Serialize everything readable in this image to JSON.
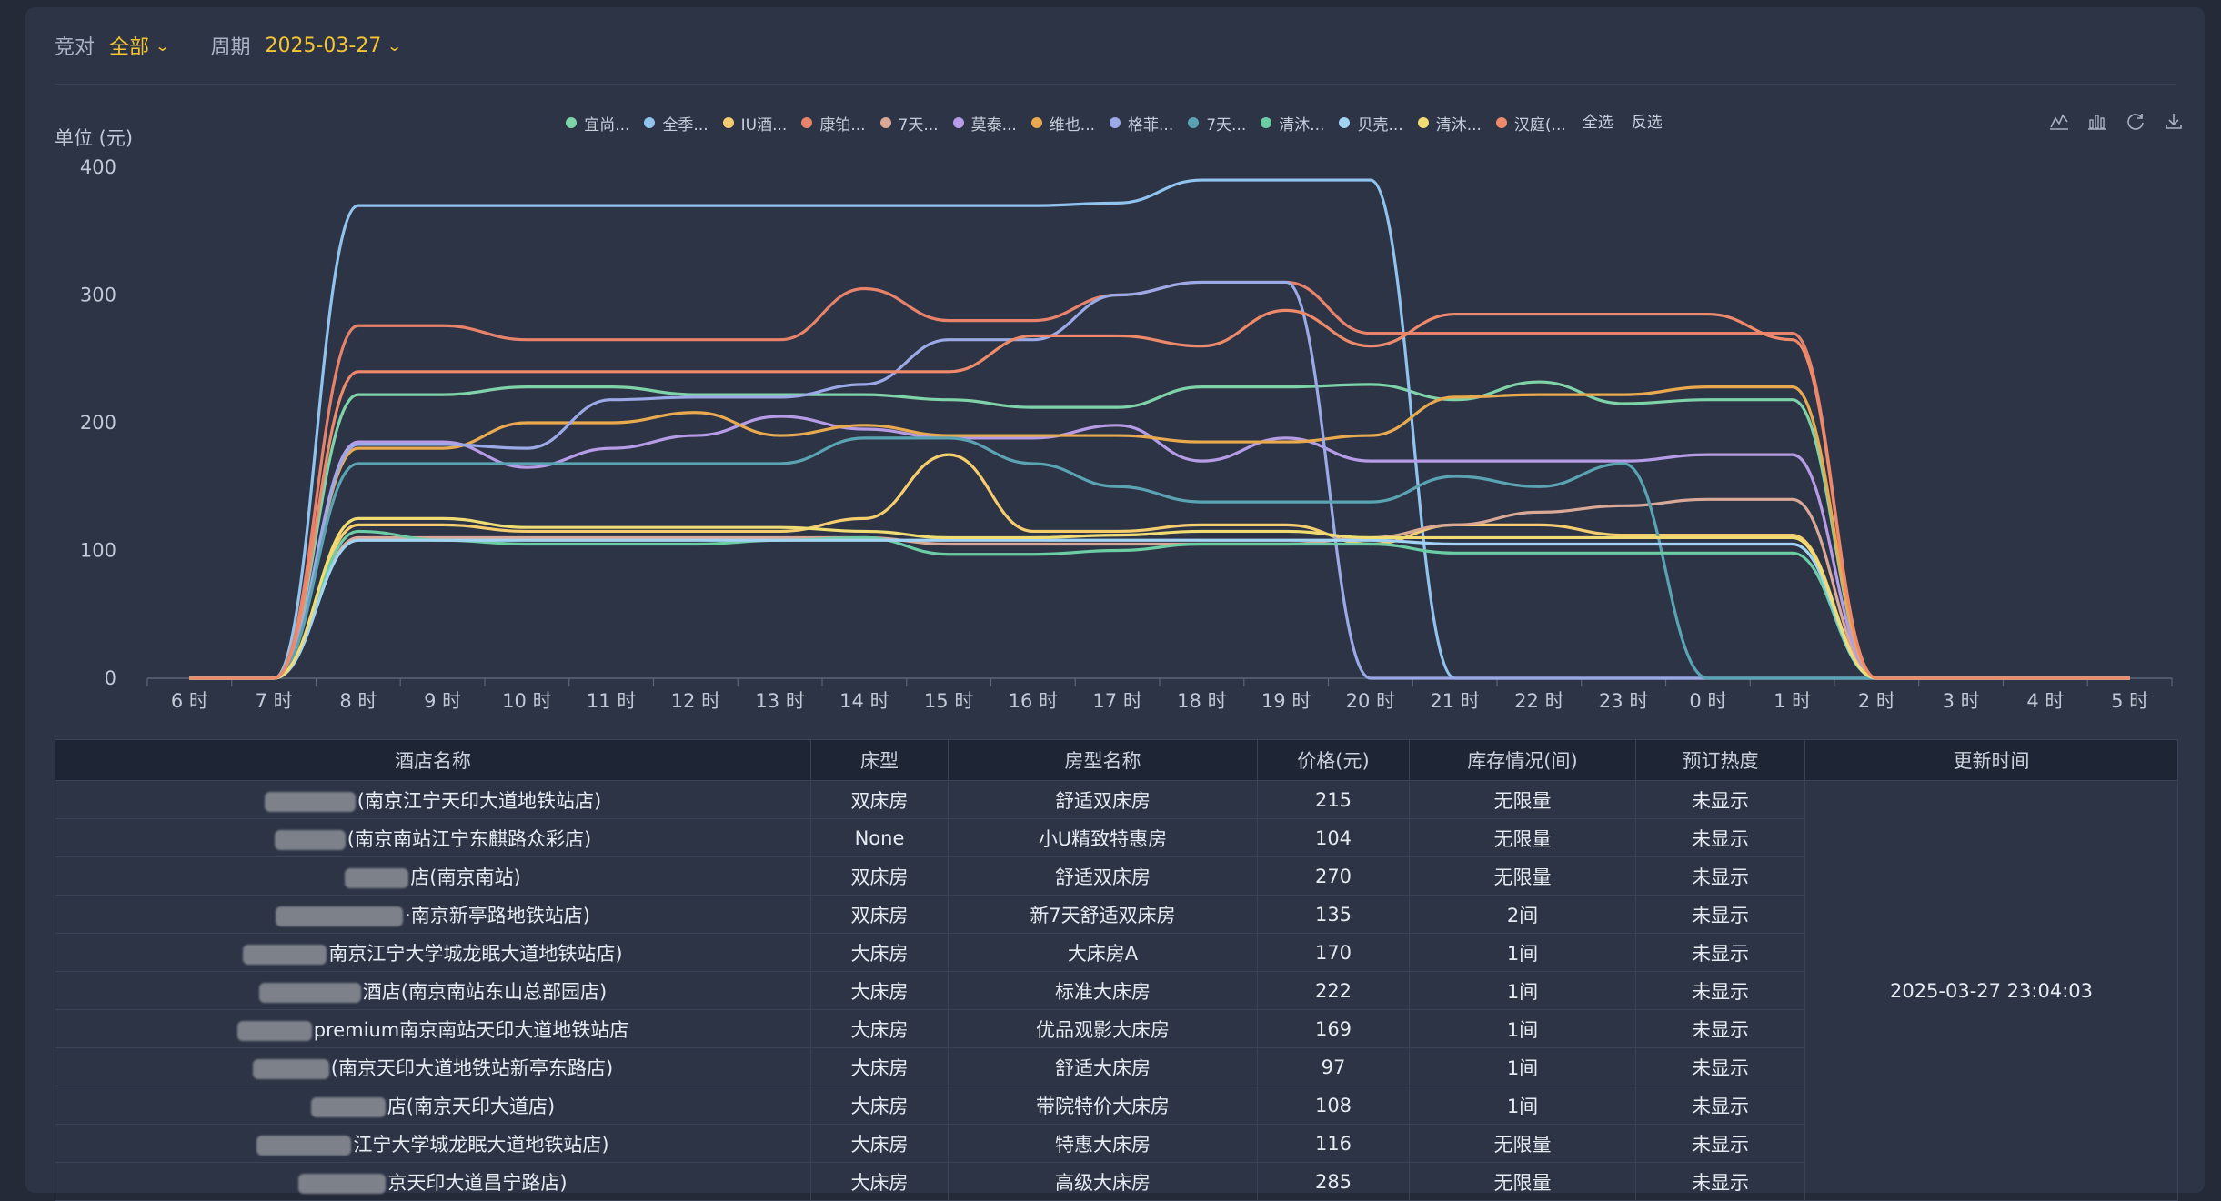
{
  "filters": {
    "rival_label": "竞对",
    "rival_value": "全部",
    "period_label": "周期",
    "period_value": "2025-03-27"
  },
  "toolbar_icons": [
    "line-chart-icon",
    "bar-chart-icon",
    "refresh-icon",
    "download-icon"
  ],
  "legend_actions": {
    "select_all": "全选",
    "invert": "反选"
  },
  "chart_data": {
    "type": "line",
    "ylabel": "单位 (元)",
    "ylim": [
      0,
      400
    ],
    "yticks": [
      0,
      100,
      200,
      300,
      400
    ],
    "x": [
      "6 时",
      "7 时",
      "8 时",
      "9 时",
      "10 时",
      "11 时",
      "12 时",
      "13 时",
      "14 时",
      "15 时",
      "16 时",
      "17 时",
      "18 时",
      "19 时",
      "20 时",
      "21 时",
      "22 时",
      "23 时",
      "0 时",
      "1 时",
      "2 时",
      "3 时",
      "4 时",
      "5 时"
    ],
    "grid": false,
    "legend_position": "top-center",
    "series": [
      {
        "name": "宜尚...",
        "color": "#7fd3a8",
        "values": [
          0,
          0,
          222,
          222,
          228,
          228,
          222,
          222,
          222,
          218,
          212,
          212,
          228,
          228,
          230,
          218,
          232,
          215,
          218,
          218,
          0,
          0,
          0,
          0
        ]
      },
      {
        "name": "全季...",
        "color": "#90c3ee",
        "values": [
          0,
          0,
          370,
          370,
          370,
          370,
          370,
          370,
          370,
          370,
          370,
          372,
          390,
          390,
          390,
          0,
          0,
          0,
          0,
          0,
          0,
          0,
          0,
          0
        ]
      },
      {
        "name": "IU酒...",
        "color": "#f5cd6e",
        "values": [
          0,
          0,
          120,
          120,
          115,
          115,
          115,
          115,
          125,
          175,
          115,
          115,
          120,
          120,
          105,
          120,
          120,
          112,
          112,
          112,
          0,
          0,
          0,
          0
        ]
      },
      {
        "name": "康铂...",
        "color": "#e8826a",
        "values": [
          0,
          0,
          276,
          276,
          265,
          265,
          265,
          265,
          305,
          280,
          280,
          300,
          310,
          310,
          270,
          270,
          270,
          270,
          270,
          270,
          0,
          0,
          0,
          0
        ]
      },
      {
        "name": "7天...",
        "color": "#d9a897",
        "values": [
          0,
          0,
          110,
          110,
          110,
          110,
          110,
          110,
          110,
          105,
          105,
          105,
          105,
          105,
          110,
          120,
          130,
          135,
          140,
          140,
          0,
          0,
          0,
          0
        ]
      },
      {
        "name": "莫泰...",
        "color": "#b69ce6",
        "values": [
          0,
          0,
          185,
          185,
          165,
          180,
          190,
          205,
          195,
          188,
          188,
          198,
          170,
          188,
          170,
          170,
          170,
          170,
          175,
          175,
          0,
          0,
          0,
          0
        ]
      },
      {
        "name": "维也...",
        "color": "#e9a94e",
        "values": [
          0,
          0,
          180,
          180,
          200,
          200,
          208,
          190,
          198,
          190,
          190,
          190,
          185,
          185,
          190,
          220,
          222,
          222,
          228,
          228,
          0,
          0,
          0,
          0
        ]
      },
      {
        "name": "格菲...",
        "color": "#9ba9e6",
        "values": [
          0,
          0,
          183,
          183,
          180,
          218,
          220,
          220,
          230,
          265,
          265,
          300,
          310,
          310,
          0,
          0,
          0,
          0,
          0,
          0,
          0,
          0,
          0,
          0
        ]
      },
      {
        "name": "7天...",
        "color": "#5aa3b2",
        "values": [
          0,
          0,
          168,
          168,
          168,
          168,
          168,
          168,
          188,
          188,
          168,
          150,
          138,
          138,
          138,
          158,
          150,
          168,
          0,
          0,
          0,
          0,
          0,
          0
        ]
      },
      {
        "name": "清沐...",
        "color": "#6ccca3",
        "values": [
          0,
          0,
          115,
          108,
          105,
          105,
          105,
          108,
          110,
          97,
          97,
          100,
          105,
          105,
          105,
          98,
          98,
          98,
          98,
          98,
          0,
          0,
          0,
          0
        ]
      },
      {
        "name": "贝壳...",
        "color": "#a3d3f3",
        "values": [
          0,
          0,
          108,
          108,
          108,
          108,
          108,
          108,
          108,
          108,
          108,
          108,
          108,
          108,
          108,
          105,
          105,
          105,
          105,
          105,
          0,
          0,
          0,
          0
        ]
      },
      {
        "name": "清沐...",
        "color": "#f0dc73",
        "values": [
          0,
          0,
          125,
          125,
          118,
          118,
          118,
          118,
          115,
          110,
          110,
          112,
          115,
          115,
          110,
          110,
          110,
          110,
          110,
          110,
          0,
          0,
          0,
          0
        ]
      },
      {
        "name": "汉庭(...",
        "color": "#ee8a6a",
        "values": [
          0,
          0,
          240,
          240,
          240,
          240,
          240,
          240,
          240,
          240,
          268,
          268,
          260,
          288,
          260,
          285,
          285,
          285,
          285,
          265,
          0,
          0,
          0,
          0
        ]
      }
    ]
  },
  "table": {
    "headers": [
      "酒店名称",
      "床型",
      "房型名称",
      "价格(元)",
      "库存情况(间)",
      "预订热度",
      "更新时间"
    ],
    "update_time": "2025-03-27 23:04:03",
    "rows": [
      {
        "name": "(南京江宁天印大道地铁站店)",
        "blur": 100,
        "bed": "双床房",
        "room": "舒适双床房",
        "price": "215",
        "stock": "无限量",
        "heat": "未显示"
      },
      {
        "name": "(南京南站江宁东麒路众彩店)",
        "blur": 78,
        "bed": "None",
        "room": "小U精致特惠房",
        "price": "104",
        "stock": "无限量",
        "heat": "未显示"
      },
      {
        "name": "店(南京南站)",
        "blur": 70,
        "bed": "双床房",
        "room": "舒适双床房",
        "price": "270",
        "stock": "无限量",
        "heat": "未显示"
      },
      {
        "name": "·南京新亭路地铁站店)",
        "blur": 140,
        "bed": "双床房",
        "room": "新7天舒适双床房",
        "price": "135",
        "stock": "2间",
        "heat": "未显示"
      },
      {
        "name": "南京江宁大学城龙眠大道地铁站店)",
        "blur": 92,
        "bed": "大床房",
        "room": "大床房A",
        "price": "170",
        "stock": "1间",
        "heat": "未显示"
      },
      {
        "name": "酒店(南京南站东山总部园店)",
        "blur": 112,
        "bed": "大床房",
        "room": "标准大床房",
        "price": "222",
        "stock": "1间",
        "heat": "未显示"
      },
      {
        "name": "premium南京南站天印大道地铁站店",
        "blur": 82,
        "bed": "大床房",
        "room": "优品观影大床房",
        "price": "169",
        "stock": "1间",
        "heat": "未显示"
      },
      {
        "name": "(南京天印大道地铁站新亭东路店)",
        "blur": 84,
        "bed": "大床房",
        "room": "舒适大床房",
        "price": "97",
        "stock": "1间",
        "heat": "未显示"
      },
      {
        "name": "店(南京天印大道店)",
        "blur": 82,
        "bed": "大床房",
        "room": "带院特价大床房",
        "price": "108",
        "stock": "1间",
        "heat": "未显示"
      },
      {
        "name": "江宁大学城龙眠大道地铁站店)",
        "blur": 104,
        "bed": "大床房",
        "room": "特惠大床房",
        "price": "116",
        "stock": "无限量",
        "heat": "未显示"
      },
      {
        "name": "京天印大道昌宁路店)",
        "blur": 96,
        "bed": "大床房",
        "room": "高级大床房",
        "price": "285",
        "stock": "无限量",
        "heat": "未显示"
      }
    ]
  }
}
